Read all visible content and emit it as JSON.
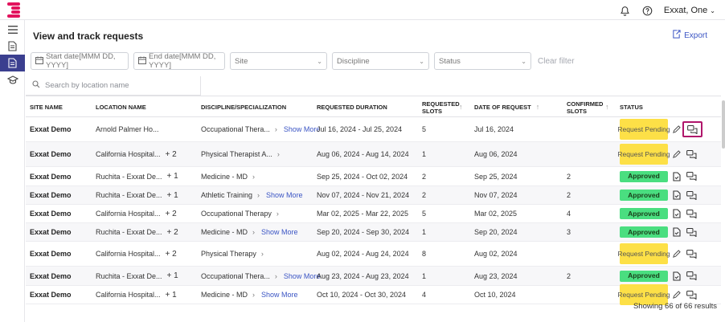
{
  "topbar": {
    "user_label": "Exxat, One",
    "icons": [
      "bell-icon",
      "help-icon",
      "chevron-down-icon"
    ]
  },
  "sidebar": {
    "items": [
      {
        "icon": "menu-icon",
        "active": false
      },
      {
        "icon": "document-icon",
        "active": false
      },
      {
        "icon": "request-icon",
        "active": true
      },
      {
        "icon": "graduation-cap-icon",
        "active": false
      }
    ]
  },
  "page": {
    "title": "View and track requests",
    "export_label": "Export"
  },
  "filters": {
    "start_date": "Start date[MMM DD, YYYY]",
    "end_date": "End date[MMM DD, YYYY]",
    "site": "Site",
    "discipline": "Discipline",
    "status": "Status",
    "clear": "Clear filter"
  },
  "search": {
    "placeholder": "Search by location name"
  },
  "table": {
    "headers": {
      "site": "SITE NAME",
      "location": "LOCATION NAME",
      "discipline": "DISCIPLINE/SPECIALIZATION",
      "duration": "REQUESTED DURATION",
      "req_slots": "REQUESTED SLOTS",
      "date": "DATE OF REQUEST",
      "conf_slots": "CONFIRMED SLOTS",
      "status": "STATUS"
    },
    "rows": [
      {
        "site": "Exxat Demo",
        "location": "Arnold Palmer Ho...",
        "plus": "",
        "discipline": "Occupational Thera...",
        "more": "Show More",
        "duration": "Jul 16, 2024  - Jul 25, 2024",
        "req": "5",
        "date": "Jul 16, 2024",
        "conf": "",
        "status": "Request Pending",
        "status_type": "pending"
      },
      {
        "site": "Exxat Demo",
        "location": "California Hospital...",
        "plus": "+ 2",
        "discipline": "Physical Therapist A...",
        "more": "",
        "duration": "Aug 06, 2024  - Aug 14, 2024",
        "req": "1",
        "date": "Aug 06, 2024",
        "conf": "",
        "status": "Request Pending",
        "status_type": "pending"
      },
      {
        "site": "Exxat Demo",
        "location": "Ruchita - Exxat De...",
        "plus": "+ 1",
        "discipline": "Medicine - MD",
        "more": "",
        "duration": "Sep 25, 2024  - Oct 02, 2024",
        "req": "2",
        "date": "Sep 25, 2024",
        "conf": "2",
        "status": "Approved",
        "status_type": "approved"
      },
      {
        "site": "Exxat Demo",
        "location": "Ruchita - Exxat De...",
        "plus": "+ 1",
        "discipline": "Athletic Training",
        "more": "Show More",
        "duration": "Nov 07, 2024  - Nov 21, 2024",
        "req": "2",
        "date": "Nov 07, 2024",
        "conf": "2",
        "status": "Approved",
        "status_type": "approved"
      },
      {
        "site": "Exxat Demo",
        "location": "California Hospital...",
        "plus": "+ 2",
        "discipline": "Occupational Therapy",
        "more": "",
        "duration": "Mar 02, 2025  - Mar 22, 2025",
        "req": "5",
        "date": "Mar 02, 2025",
        "conf": "4",
        "status": "Approved",
        "status_type": "approved"
      },
      {
        "site": "Exxat Demo",
        "location": "Ruchita - Exxat De...",
        "plus": "+ 2",
        "discipline": "Medicine - MD",
        "more": "Show More",
        "duration": "Sep 20, 2024  - Sep 30, 2024",
        "req": "1",
        "date": "Sep 20, 2024",
        "conf": "3",
        "status": "Approved",
        "status_type": "approved"
      },
      {
        "site": "Exxat Demo",
        "location": "California Hospital...",
        "plus": "+ 2",
        "discipline": "Physical Therapy",
        "more": "",
        "duration": "Aug 02, 2024  - Aug 24, 2024",
        "req": "8",
        "date": "Aug 02, 2024",
        "conf": "",
        "status": "Request Pending",
        "status_type": "pending"
      },
      {
        "site": "Exxat Demo",
        "location": "Ruchita - Exxat De...",
        "plus": "+ 1",
        "discipline": "Occupational Thera...",
        "more": "Show More",
        "duration": "Aug 23, 2024  - Aug 23, 2024",
        "req": "1",
        "date": "Aug 23, 2024",
        "conf": "2",
        "status": "Approved",
        "status_type": "approved"
      },
      {
        "site": "Exxat Demo",
        "location": "California Hospital...",
        "plus": "+ 1",
        "discipline": "Medicine - MD",
        "more": "Show More",
        "duration": "Oct 10, 2024  - Oct 30, 2024",
        "req": "4",
        "date": "Oct 10, 2024",
        "conf": "",
        "status": "Request Pending",
        "status_type": "pending"
      }
    ]
  },
  "footer": {
    "results": "Showing 66 of 66 results"
  },
  "colors": {
    "accent": "#3b55c4",
    "brand": "#e2135d",
    "pending": "#fde047",
    "approved": "#4ade80",
    "highlight": "#b0166b"
  }
}
